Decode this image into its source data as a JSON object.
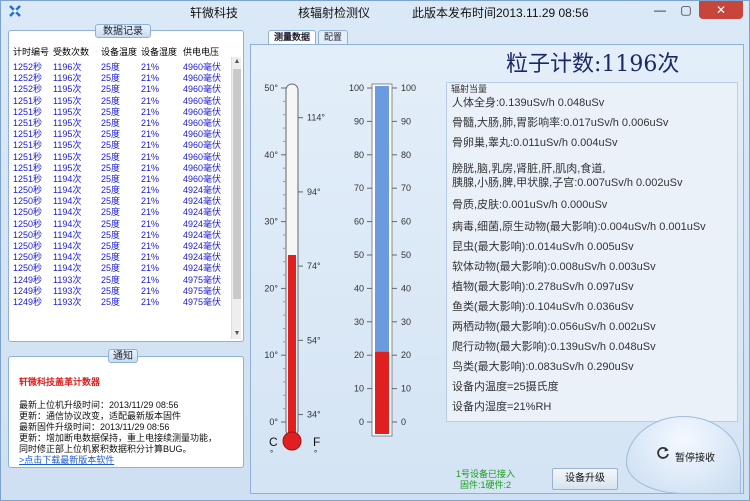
{
  "window": {
    "app_name": "轩微科技",
    "device_name": "核辐射检测仪",
    "release": "此版本发布时间2013.11.29 08:56",
    "min_glyph": "—",
    "max_glyph": "▢",
    "close_glyph": "✕"
  },
  "records": {
    "title": "数据记录",
    "columns": [
      "计时编号",
      "受数次数",
      "设备温度",
      "设备湿度",
      "供电电压"
    ],
    "rows": [
      [
        "1252秒",
        "1196次",
        "25度",
        "21%",
        "4960毫伏"
      ],
      [
        "1252秒",
        "1196次",
        "25度",
        "21%",
        "4960毫伏"
      ],
      [
        "1252秒",
        "1195次",
        "25度",
        "21%",
        "4960毫伏"
      ],
      [
        "1251秒",
        "1195次",
        "25度",
        "21%",
        "4960毫伏"
      ],
      [
        "1251秒",
        "1195次",
        "25度",
        "21%",
        "4960毫伏"
      ],
      [
        "1251秒",
        "1195次",
        "25度",
        "21%",
        "4960毫伏"
      ],
      [
        "1251秒",
        "1195次",
        "25度",
        "21%",
        "4960毫伏"
      ],
      [
        "1251秒",
        "1195次",
        "25度",
        "21%",
        "4960毫伏"
      ],
      [
        "1251秒",
        "1195次",
        "25度",
        "21%",
        "4960毫伏"
      ],
      [
        "1251秒",
        "1195次",
        "25度",
        "21%",
        "4960毫伏"
      ],
      [
        "1251秒",
        "1194次",
        "25度",
        "21%",
        "4960毫伏"
      ],
      [
        "1250秒",
        "1194次",
        "25度",
        "21%",
        "4924毫伏"
      ],
      [
        "1250秒",
        "1194次",
        "25度",
        "21%",
        "4924毫伏"
      ],
      [
        "1250秒",
        "1194次",
        "25度",
        "21%",
        "4924毫伏"
      ],
      [
        "1250秒",
        "1194次",
        "25度",
        "21%",
        "4924毫伏"
      ],
      [
        "1250秒",
        "1194次",
        "25度",
        "21%",
        "4924毫伏"
      ],
      [
        "1250秒",
        "1194次",
        "25度",
        "21%",
        "4924毫伏"
      ],
      [
        "1250秒",
        "1194次",
        "25度",
        "21%",
        "4924毫伏"
      ],
      [
        "1250秒",
        "1194次",
        "25度",
        "21%",
        "4924毫伏"
      ],
      [
        "1249秒",
        "1193次",
        "25度",
        "21%",
        "4975毫伏"
      ],
      [
        "1249秒",
        "1193次",
        "25度",
        "21%",
        "4975毫伏"
      ],
      [
        "1249秒",
        "1193次",
        "25度",
        "21%",
        "4975毫伏"
      ]
    ]
  },
  "notice": {
    "title": "通知",
    "headline": "轩微科技盖革计数器",
    "lines": [
      "最新上位机升级时间：2013/11/29 08:56",
      "更新：通信协议改变，适配最新版本固件",
      "最新固件升级时间：2013/11/29 08:56",
      "更新：增加断电数据保持，重上电接续测量功能，",
      "同时修正部上位机累积数据积分计算BUG。"
    ],
    "link": ">点击下载最新版本软件"
  },
  "tabs": [
    {
      "label": "测量数据",
      "active": true
    },
    {
      "label": "配置",
      "active": false
    }
  ],
  "count_text": "粒子计数:1196次",
  "thermometer": {
    "celsius_ticks": [
      "50°",
      "40°",
      "30°",
      "20°",
      "10°",
      "0°"
    ],
    "fahrenheit_ticks": [
      "114°",
      "94°",
      "74°",
      "54°",
      "34°"
    ],
    "c_label": "C",
    "f_label": "F",
    "unit_mark": "°",
    "temperature_c": 25,
    "color": "#e02020"
  },
  "humidity": {
    "ticks": [
      "100",
      "90",
      "80",
      "70",
      "60",
      "50",
      "40",
      "30",
      "20",
      "10",
      "0"
    ],
    "value_percent": 21,
    "fill_color": "#6a9ae0",
    "level_color": "#e02020"
  },
  "radiation": {
    "title": "辐射当量",
    "lines": [
      "人体全身:0.139uSv/h 0.048uSv",
      "骨髓,大肠,肺,胃影响率:0.017uSv/h 0.006uSv",
      "骨卵巢,睾丸:0.011uSv/h 0.004uSv",
      "膀胱,脑,乳房,肾脏,肝,肌肉,食道,",
      "胰腺,小肠,脾,甲状腺,子宫:0.007uSv/h 0.002uSv",
      "骨质,皮肤:0.001uSv/h 0.000uSv",
      "病毒,细菌,原生动物(最大影响):0.004uSv/h 0.001uSv",
      "昆虫(最大影响):0.014uSv/h 0.005uSv",
      "软体动物(最大影响):0.008uSv/h 0.003uSv",
      "植物(最大影响):0.278uSv/h 0.097uSv",
      "鱼类(最大影响):0.104uSv/h 0.036uSv",
      "两栖动物(最大影响):0.056uSv/h 0.002uSv",
      "爬行动物(最大影响):0.139uSv/h 0.048uSv",
      "鸟类(最大影响):0.083uSv/h 0.290uSv",
      "设备内温度=25摄氏度",
      "设备内湿度=21%RH"
    ]
  },
  "controls": {
    "stop_label": "暂停接收",
    "status_line1": "1号设备已接入",
    "status_line2": "固件:1硬件:2",
    "upgrade_label": "设备升级"
  }
}
